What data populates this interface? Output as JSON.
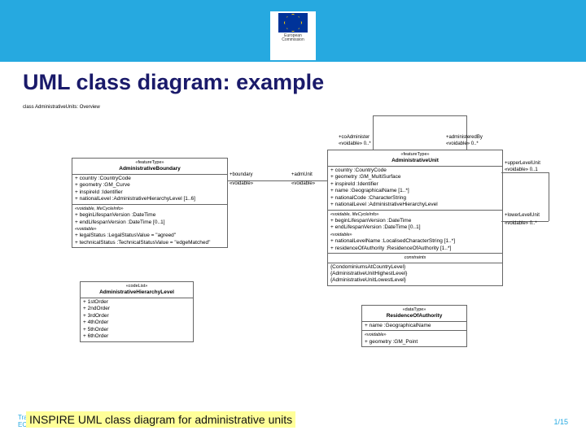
{
  "logo": {
    "line1": "European",
    "line2": "Commission"
  },
  "title": "UML class diagram: example",
  "caption": "INSPIRE UML class diagram for administrative units",
  "page": "1/15",
  "footer": {
    "l1": "Train",
    "l2": "EC J"
  },
  "diag": {
    "overview": "class AdministrativeUnits: Overview"
  },
  "ab": {
    "stereo": "«featureType»",
    "name": "AdministrativeBoundary",
    "a1": "+  country :CountryCode",
    "a2": "+  geometry :GM_Curve",
    "a3": "+  inspireId :Identifier",
    "a4": "+  nationalLevel :AdministrativeHierarchyLevel [1..6]",
    "v": "«voidable, lifeCycleInfo»",
    "a5": "+  beginLifespanVersion :DateTime",
    "a6": "+  endLifespanVersion :DateTime [0..1]",
    "v2": "«voidable»",
    "a7": "+  legalStatus :LegalStatusValue = \"agreed\"",
    "a8": "+  technicalStatus :TechnicalStatusValue = \"edgeMatched\""
  },
  "au": {
    "stereo": "«featureType»",
    "name": "AdministrativeUnit",
    "a1": "+  country :CountryCode",
    "a2": "+  geometry :GM_MultiSurface",
    "a3": "+  inspireId :Identifier",
    "a4": "+  name :GeographicalName [1..*]",
    "a5": "+  nationalCode :CharacterString",
    "a6": "+  nationalLevel :AdministrativeHierarchyLevel",
    "v": "«voidable, lifeCycleInfo»",
    "a7": "+  beginLifespanVersion :DateTime",
    "a8": "+  endLifespanVersion :DateTime [0..1]",
    "v2": "«voidable»",
    "a9": "+  nationalLevelName :LocalisedCharacterString [1..*]",
    "a10": "+  residenceOfAuthority :ResidenceOfAuthority [1..*]",
    "c": "constraints",
    "c1": "{CondominiumsAtCountryLevel}",
    "c2": "{AdministrativeUnitHighestLevel}",
    "c3": "{AdministrativeUnitLowestLevel}"
  },
  "ahl": {
    "stereo": "«codeList»",
    "name": "AdministrativeHierarchyLevel",
    "o1": "+  1stOrder",
    "o2": "+  2ndOrder",
    "o3": "+  3rdOrder",
    "o4": "+  4thOrder",
    "o5": "+  5thOrder",
    "o6": "+  6thOrder"
  },
  "roa": {
    "stereo": "«dataType»",
    "name": "ResidenceOfAuthority",
    "a1": "+  name :GeographicalName",
    "v": "«voidable»",
    "a2": "+  geometry :GM_Point"
  },
  "rel": {
    "coAdmin": "+coAdminister",
    "coAdminCard": "«voidable» 0..*",
    "adminBy": "+administeredBy",
    "adminByCard": "«voidable» 0..*",
    "boundary": "+boundary",
    "boundaryV": "«voidable»",
    "admUnit": "+admUnit",
    "admUnitV": "«voidable»",
    "upper": "+upperLevelUnit",
    "upperCard": "«voidable» 0..1",
    "lower": "+lowerLevelUnit",
    "lowerCard": "«voidable» 0..*"
  }
}
